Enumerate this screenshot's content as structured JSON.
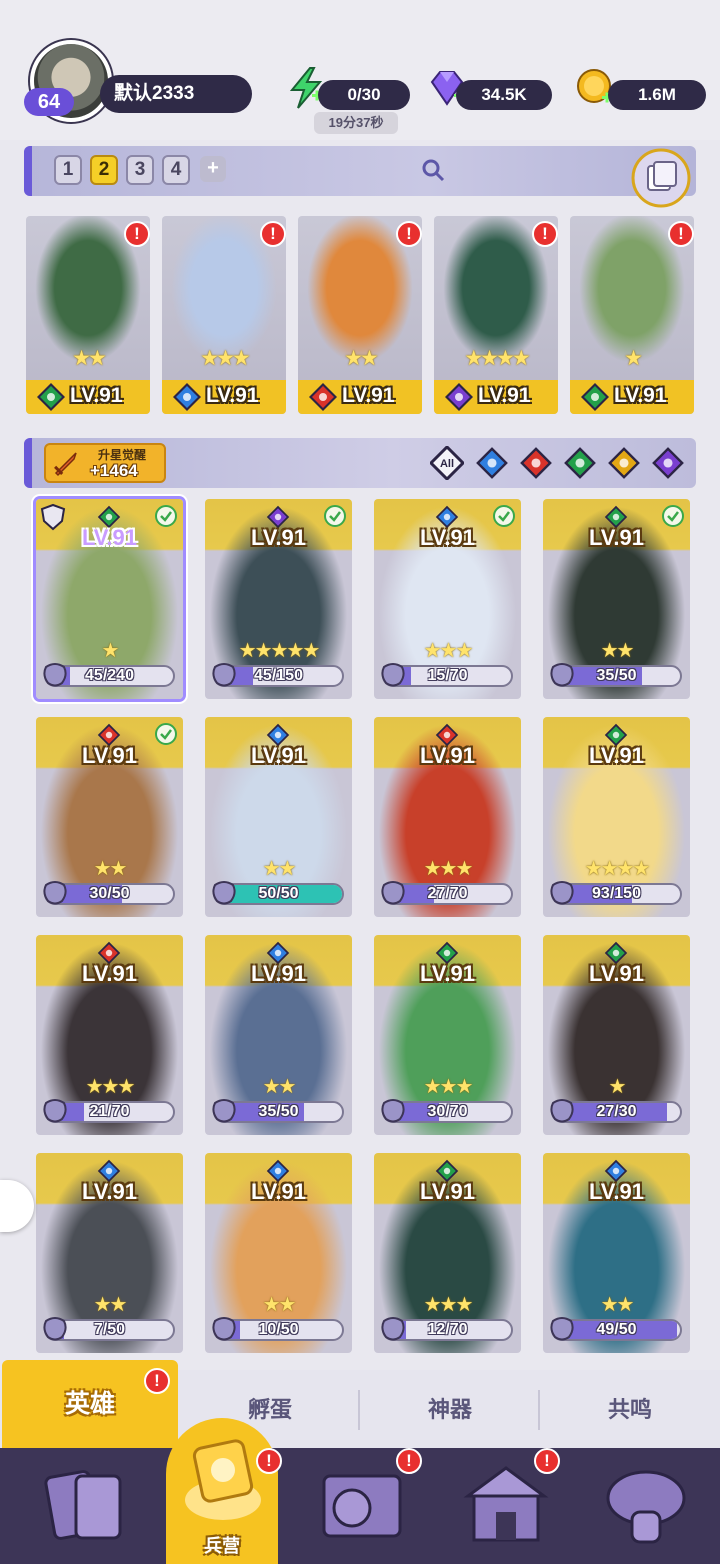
{
  "player": {
    "level": "64",
    "name": "默认2333"
  },
  "resources": {
    "energy": "0/30",
    "energy_timer": "19分37秒",
    "gems": "34.5K",
    "gold": "1.6M"
  },
  "teams": {
    "tabs": [
      "1",
      "2",
      "3",
      "4"
    ],
    "active": "2",
    "add_label": "+"
  },
  "team_lineup": [
    {
      "level": "LV.91",
      "element": "nature",
      "stars": "★★"
    },
    {
      "level": "LV.91",
      "element": "water",
      "stars": "★★★"
    },
    {
      "level": "LV.91",
      "element": "fire",
      "stars": "★★"
    },
    {
      "level": "LV.91",
      "element": "dark",
      "stars": "★★★★"
    },
    {
      "level": "LV.91",
      "element": "nature",
      "stars": "★"
    }
  ],
  "awaken": {
    "label": "升星觉醒",
    "value": "+1464"
  },
  "filters": {
    "all_label": "All",
    "elements": [
      "water",
      "fire",
      "nature",
      "light",
      "dark"
    ]
  },
  "heroes": [
    {
      "level": "LV.91",
      "element": "nature",
      "shards": "45/240",
      "progress": 0.1875,
      "stars": "★",
      "checked": true,
      "locked": true
    },
    {
      "level": "LV.91",
      "element": "dark",
      "shards": "45/150",
      "progress": 0.3,
      "stars": "★★★★★",
      "checked": true
    },
    {
      "level": "LV.91",
      "element": "water",
      "shards": "15/70",
      "progress": 0.21,
      "stars": "★★★",
      "checked": true
    },
    {
      "level": "LV.91",
      "element": "nature",
      "shards": "35/50",
      "progress": 0.7,
      "stars": "★★",
      "checked": true
    },
    {
      "level": "LV.91",
      "element": "fire",
      "shards": "30/50",
      "progress": 0.6,
      "stars": "★★",
      "checked": true
    },
    {
      "level": "LV.91",
      "element": "water",
      "shards": "50/50",
      "progress": 1.0,
      "stars": "★★"
    },
    {
      "level": "LV.91",
      "element": "fire",
      "shards": "27/70",
      "progress": 0.39,
      "stars": "★★★"
    },
    {
      "level": "LV.91",
      "element": "nature",
      "shards": "93/150",
      "progress": 0.62,
      "stars": "★★★★"
    },
    {
      "level": "LV.91",
      "element": "fire",
      "shards": "21/70",
      "progress": 0.3,
      "stars": "★★★"
    },
    {
      "level": "LV.91",
      "element": "water",
      "shards": "35/50",
      "progress": 0.7,
      "stars": "★★"
    },
    {
      "level": "LV.91",
      "element": "nature",
      "shards": "30/70",
      "progress": 0.43,
      "stars": "★★★"
    },
    {
      "level": "LV.91",
      "element": "nature",
      "shards": "27/30",
      "progress": 0.9,
      "stars": "★"
    },
    {
      "level": "LV.91",
      "element": "water",
      "shards": "7/50",
      "progress": 0.14,
      "stars": "★★"
    },
    {
      "level": "LV.91",
      "element": "water",
      "shards": "10/50",
      "progress": 0.2,
      "stars": "★★"
    },
    {
      "level": "LV.91",
      "element": "nature",
      "shards": "12/70",
      "progress": 0.17,
      "stars": "★★★"
    },
    {
      "level": "LV.91",
      "element": "water",
      "shards": "49/50",
      "progress": 0.98,
      "stars": "★★"
    }
  ],
  "subtabs": [
    "英雄",
    "孵蛋",
    "神器",
    "共鸣"
  ],
  "nav": {
    "center_label": "兵营"
  },
  "colors": {
    "water": "#2f7fe0",
    "fire": "#d9332a",
    "nature": "#23a04a",
    "light": "#e3a714",
    "dark": "#7a3fd0",
    "accent": "#f6c321"
  }
}
